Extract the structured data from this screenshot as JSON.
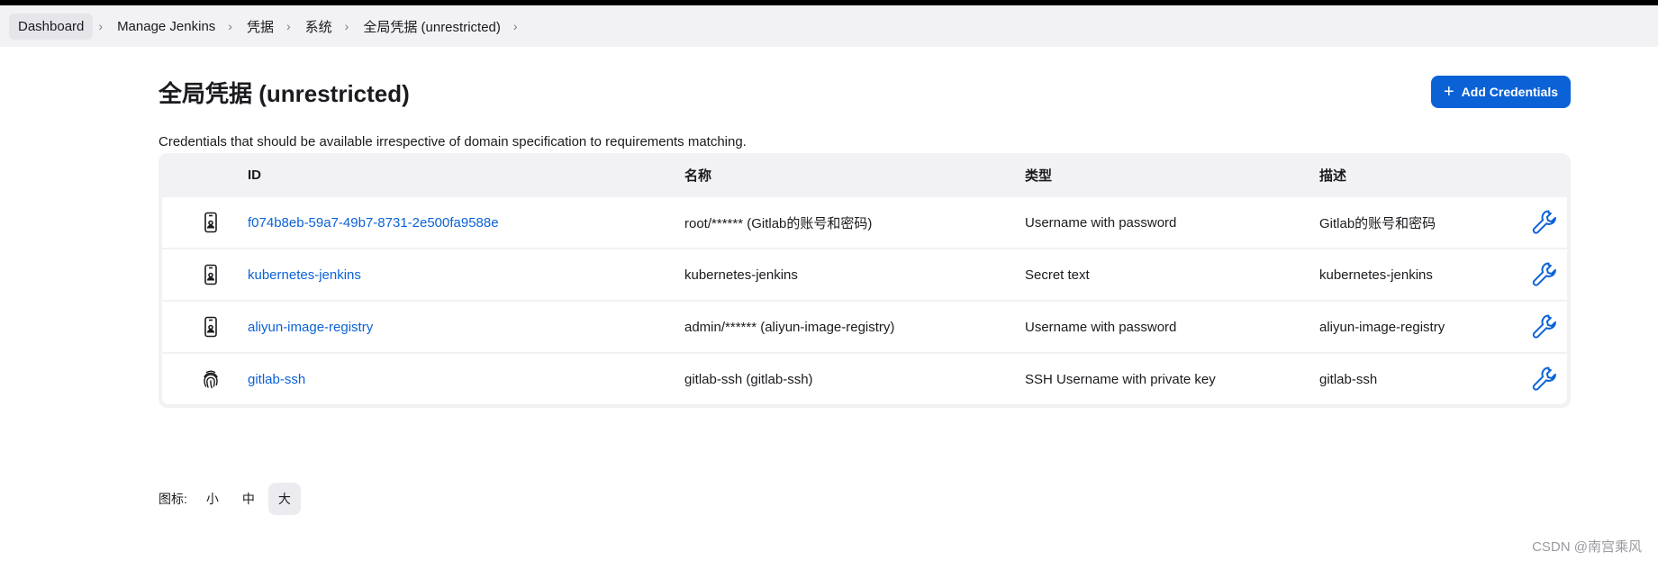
{
  "breadcrumb": [
    {
      "label": "Dashboard"
    },
    {
      "label": "Manage Jenkins"
    },
    {
      "label": "凭据"
    },
    {
      "label": "系统"
    },
    {
      "label": "全局凭据 (unrestricted)"
    }
  ],
  "page": {
    "title": "全局凭据 (unrestricted)",
    "add_button_label": "Add Credentials",
    "description": "Credentials that should be available irrespective of domain specification to requirements matching."
  },
  "table": {
    "headers": {
      "id": "ID",
      "name": "名称",
      "type": "类型",
      "description": "描述"
    },
    "rows": [
      {
        "icon": "phone-user-icon",
        "id": "f074b8eb-59a7-49b7-8731-2e500fa9588e",
        "name": "root/****** (Gitlab的账号和密码)",
        "type": "Username with password",
        "description": "Gitlab的账号和密码"
      },
      {
        "icon": "phone-user-icon",
        "id": "kubernetes-jenkins",
        "name": "kubernetes-jenkins",
        "type": "Secret text",
        "description": "kubernetes-jenkins"
      },
      {
        "icon": "phone-user-icon",
        "id": "aliyun-image-registry",
        "name": "admin/****** (aliyun-image-registry)",
        "type": "Username with password",
        "description": "aliyun-image-registry"
      },
      {
        "icon": "fingerprint-icon",
        "id": "gitlab-ssh",
        "name": "gitlab-ssh (gitlab-ssh)",
        "type": "SSH Username with private key",
        "description": "gitlab-ssh"
      }
    ]
  },
  "icon_size": {
    "label": "图标:",
    "options": [
      "小",
      "中",
      "大"
    ],
    "selected": "大"
  },
  "watermark": "CSDN @南宫乘风",
  "colors": {
    "accent": "#0b62d6",
    "breadcrumb_bg": "#f2f2f4"
  }
}
